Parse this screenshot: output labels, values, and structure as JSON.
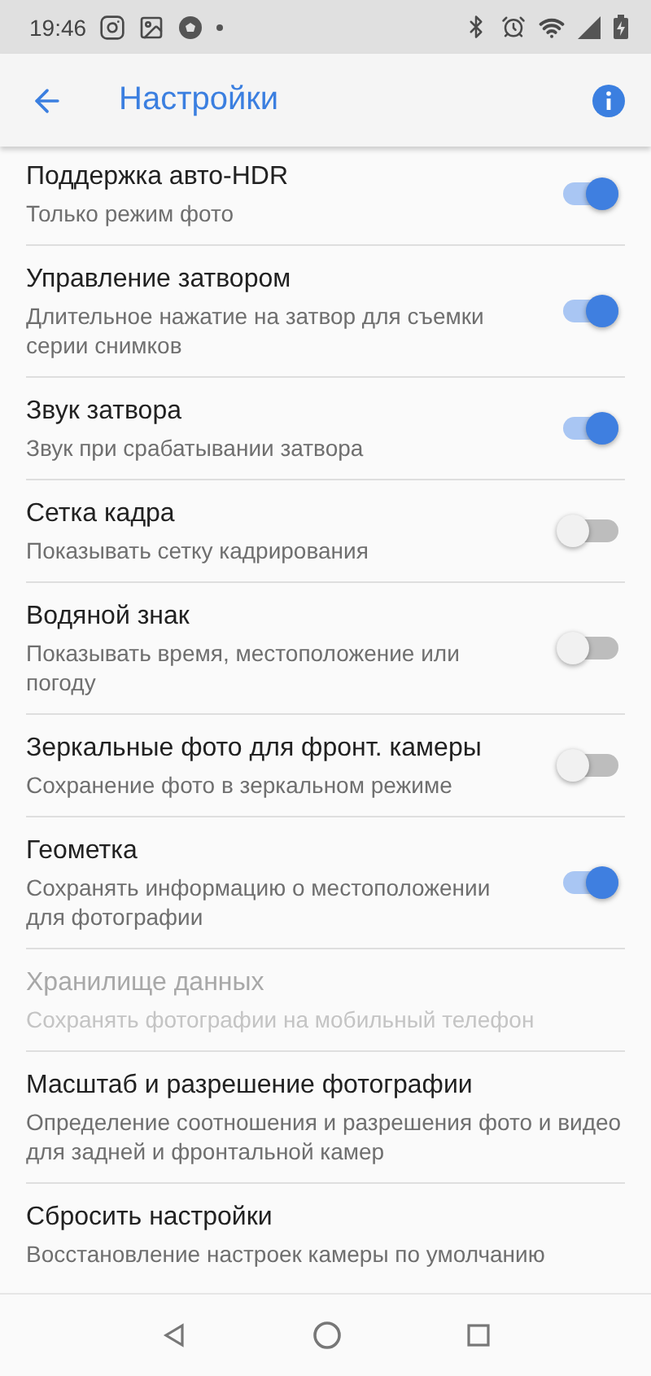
{
  "status_bar": {
    "time": "19:46"
  },
  "app_bar": {
    "title": "Настройки"
  },
  "settings": [
    {
      "kind": "switch",
      "title": "Поддержка авто-HDR",
      "subtitle": "Только режим фото",
      "on": true,
      "disabled": false
    },
    {
      "kind": "switch",
      "title": "Управление затвором",
      "subtitle": "Длительное нажатие на затвор для съемки серии снимков",
      "on": true,
      "disabled": false
    },
    {
      "kind": "switch",
      "title": "Звук затвора",
      "subtitle": "Звук при срабатывании затвора",
      "on": true,
      "disabled": false
    },
    {
      "kind": "switch",
      "title": "Сетка кадра",
      "subtitle": "Показывать сетку кадрирования",
      "on": false,
      "disabled": false
    },
    {
      "kind": "switch",
      "title": "Водяной знак",
      "subtitle": "Показывать время, местоположение или погоду",
      "on": false,
      "disabled": false
    },
    {
      "kind": "switch",
      "title": "Зеркальные фото для фронт. камеры",
      "subtitle": "Сохранение фото в зеркальном режиме",
      "on": false,
      "disabled": false
    },
    {
      "kind": "switch",
      "title": "Геометка",
      "subtitle": "Сохранять информацию о местоположении для фотографии",
      "on": true,
      "disabled": false
    },
    {
      "kind": "plain",
      "title": "Хранилище данных",
      "subtitle": "Сохранять фотографии на мобильный телефон",
      "disabled": true
    },
    {
      "kind": "plain",
      "title": "Масштаб и разрешение фотографии",
      "subtitle": "Определение соотношения и разрешения фото и видео для задней и фронтальной камер",
      "disabled": false
    },
    {
      "kind": "plain",
      "title": "Сбросить настройки",
      "subtitle": "Восстановление настроек камеры по умолчанию",
      "disabled": false
    }
  ]
}
